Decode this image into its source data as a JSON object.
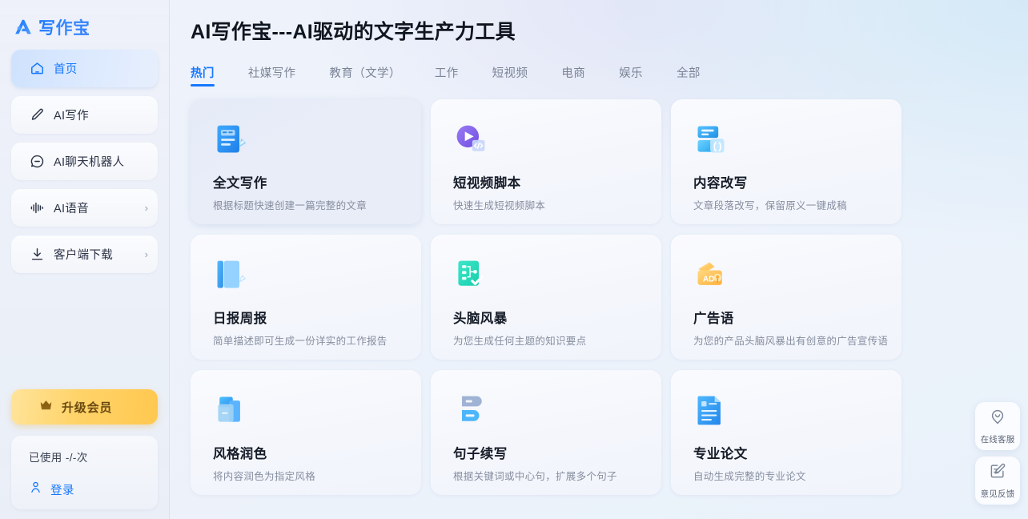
{
  "sidebar": {
    "logo_text": "写作宝",
    "logo_icon": "brand-triangle-icon",
    "items": [
      {
        "label": "首页",
        "icon": "home-icon",
        "active": true,
        "chevron": ""
      },
      {
        "label": "AI写作",
        "icon": "pencil-icon",
        "active": false,
        "chevron": ""
      },
      {
        "label": "AI聊天机器人",
        "icon": "chat-minus-icon",
        "active": false,
        "chevron": ""
      },
      {
        "label": "AI语音",
        "icon": "waveform-icon",
        "active": false,
        "chevron": "›"
      },
      {
        "label": "客户端下载",
        "icon": "download-icon",
        "active": false,
        "chevron": "›"
      }
    ],
    "upgrade": {
      "label": "升级会员",
      "icon": "crown-icon"
    },
    "account": {
      "usage_text": "已使用 -/-次",
      "login_label": "登录",
      "login_icon": "user-icon"
    }
  },
  "header": {
    "title": "AI写作宝---AI驱动的文字生产力工具"
  },
  "tabs": [
    {
      "label": "热门",
      "active": true
    },
    {
      "label": "社媒写作",
      "active": false
    },
    {
      "label": "教育（文学）",
      "active": false
    },
    {
      "label": "工作",
      "active": false
    },
    {
      "label": "短视频",
      "active": false
    },
    {
      "label": "电商",
      "active": false
    },
    {
      "label": "娱乐",
      "active": false
    },
    {
      "label": "全部",
      "active": false
    }
  ],
  "cards": [
    {
      "title": "全文写作",
      "desc": "根据标题快速创建一篇完整的文章",
      "icon": "document-pencil-icon",
      "hovered": true
    },
    {
      "title": "短视频脚本",
      "desc": "快速生成短视频脚本",
      "icon": "video-play-code-icon",
      "hovered": false
    },
    {
      "title": "内容改写",
      "desc": "文章段落改写，保留原义一键成稿",
      "icon": "rewrite-braces-icon",
      "hovered": false
    },
    {
      "title": "日报周报",
      "desc": "简单描述即可生成一份详实的工作报告",
      "icon": "report-book-icon",
      "hovered": false
    },
    {
      "title": "头脑风暴",
      "desc": "为您生成任何主题的知识要点",
      "icon": "mindmap-check-icon",
      "hovered": false
    },
    {
      "title": "广告语",
      "desc": "为您的产品头脑风暴出有创意的广告宣传语",
      "icon": "ad-megaphone-icon",
      "hovered": false
    },
    {
      "title": "风格润色",
      "desc": "将内容润色为指定风格",
      "icon": "layers-polish-icon",
      "hovered": false
    },
    {
      "title": "句子续写",
      "desc": "根据关键词或中心句，扩展多个句子",
      "icon": "sentence-blocks-icon",
      "hovered": false
    },
    {
      "title": "专业论文",
      "desc": "自动生成完整的专业论文",
      "icon": "paper-doc-icon",
      "hovered": false
    }
  ],
  "float_dock": [
    {
      "label": "在线客服",
      "icon": "smiley-pin-icon"
    },
    {
      "label": "意见反馈",
      "icon": "feedback-edit-icon"
    }
  ],
  "colors": {
    "accent_blue": "#1677ff",
    "upgrade_gold": "#ffd369",
    "card_bg": "#f6f8fd",
    "text_primary": "#161c28",
    "text_muted": "#868e9f"
  }
}
